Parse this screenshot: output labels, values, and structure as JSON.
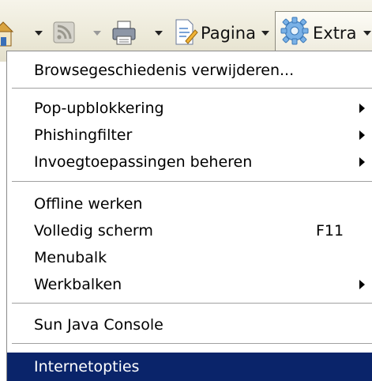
{
  "toolbar": {
    "icons": [
      "home-icon",
      "feed-icon",
      "print-icon",
      "page-icon",
      "gear-icon"
    ],
    "page_label": "Pagina",
    "extra_label": "Extra"
  },
  "menu": {
    "items": [
      {
        "label": "Browsegeschiedenis verwijderen...",
        "shortcut": "",
        "submenu": false
      },
      {
        "label": "Pop-upblokkering",
        "shortcut": "",
        "submenu": true
      },
      {
        "label": "Phishingfilter",
        "shortcut": "",
        "submenu": true
      },
      {
        "label": "Invoegtoepassingen beheren",
        "shortcut": "",
        "submenu": true
      },
      {
        "label": "Offline werken",
        "shortcut": "",
        "submenu": false
      },
      {
        "label": "Volledig scherm",
        "shortcut": "F11",
        "submenu": false
      },
      {
        "label": "Menubalk",
        "shortcut": "",
        "submenu": false
      },
      {
        "label": "Werkbalken",
        "shortcut": "",
        "submenu": true
      },
      {
        "label": "Sun Java Console",
        "shortcut": "",
        "submenu": false
      },
      {
        "label": "Internetopties",
        "shortcut": "",
        "submenu": false
      }
    ],
    "selected_item": "Internetopties",
    "colors": {
      "highlight": "#0a246a",
      "highlight_text": "#ffffff"
    }
  }
}
